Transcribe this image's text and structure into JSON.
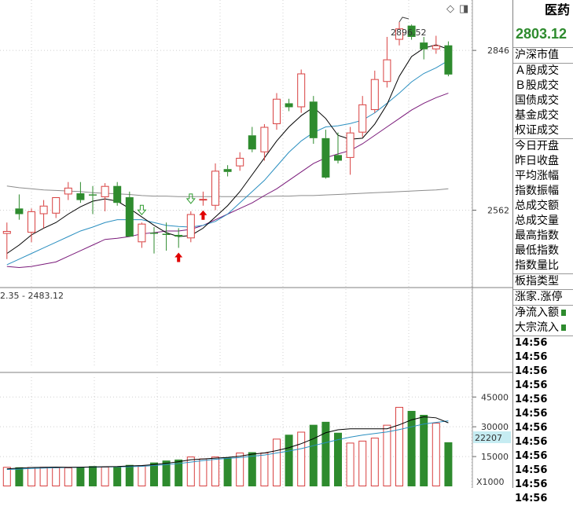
{
  "sidebar": {
    "sector_name": "医药",
    "last_price": "2803.12",
    "items": [
      "沪深市值",
      "Ａ股成交",
      "Ｂ股成交",
      "国债成交",
      "基金成交",
      "权证成交",
      "今日开盘",
      "昨日收盘",
      "平均涨幅",
      "指数振幅",
      "总成交额",
      "总成交量",
      "最高指数",
      "最低指数",
      "指数量比",
      "板指类型",
      "涨家.涨停",
      "净流入额",
      "大宗流入"
    ],
    "times": [
      "14:56",
      "14:56",
      "14:56",
      "14:56",
      "14:56",
      "14:56",
      "14:56",
      "14:56",
      "14:56",
      "14:56",
      "14:56",
      "14:56"
    ]
  },
  "toolbar": {
    "diamond": "◇",
    "window": "◨"
  },
  "colors": {
    "up": "#d84040",
    "down": "#2e8b2e",
    "ma5": "#000000",
    "ma10": "#2a8fc0",
    "ma20": "#7a1a7a",
    "ma60": "#8c8c8c"
  },
  "chart_data": [
    {
      "type": "candlestick",
      "ylim": [
        2430,
        2930
      ],
      "y_ticks": [
        2846,
        2562
      ],
      "highest_label": "2896.52",
      "range_label": "2.35 - 2483.12",
      "ohlc": [
        {
          "o": 2520,
          "h": 2540,
          "l": 2475,
          "c": 2525
        },
        {
          "o": 2565,
          "h": 2590,
          "l": 2545,
          "c": 2555
        },
        {
          "o": 2522,
          "h": 2565,
          "l": 2505,
          "c": 2560
        },
        {
          "o": 2555,
          "h": 2580,
          "l": 2530,
          "c": 2570
        },
        {
          "o": 2556,
          "h": 2580,
          "l": 2548,
          "c": 2585
        },
        {
          "o": 2590,
          "h": 2612,
          "l": 2580,
          "c": 2602
        },
        {
          "o": 2592,
          "h": 2612,
          "l": 2575,
          "c": 2580
        },
        {
          "o": 2590,
          "h": 2605,
          "l": 2555,
          "c": 2588
        },
        {
          "o": 2585,
          "h": 2610,
          "l": 2560,
          "c": 2605
        },
        {
          "o": 2605,
          "h": 2612,
          "l": 2570,
          "c": 2575
        },
        {
          "o": 2585,
          "h": 2595,
          "l": 2525,
          "c": 2515
        },
        {
          "o": 2505,
          "h": 2540,
          "l": 2495,
          "c": 2538
        },
        {
          "o": 2522,
          "h": 2532,
          "l": 2485,
          "c": 2520
        },
        {
          "o": 2520,
          "h": 2540,
          "l": 2490,
          "c": 2518
        },
        {
          "o": 2518,
          "h": 2530,
          "l": 2495,
          "c": 2515
        },
        {
          "o": 2512,
          "h": 2560,
          "l": 2505,
          "c": 2555
        },
        {
          "o": 2580,
          "h": 2595,
          "l": 2570,
          "c": 2582
        },
        {
          "o": 2570,
          "h": 2645,
          "l": 2562,
          "c": 2632
        },
        {
          "o": 2635,
          "h": 2642,
          "l": 2622,
          "c": 2630
        },
        {
          "o": 2640,
          "h": 2665,
          "l": 2632,
          "c": 2655
        },
        {
          "o": 2695,
          "h": 2710,
          "l": 2665,
          "c": 2670
        },
        {
          "o": 2665,
          "h": 2715,
          "l": 2650,
          "c": 2710
        },
        {
          "o": 2715,
          "h": 2770,
          "l": 2705,
          "c": 2760
        },
        {
          "o": 2752,
          "h": 2760,
          "l": 2738,
          "c": 2745
        },
        {
          "o": 2745,
          "h": 2812,
          "l": 2735,
          "c": 2805
        },
        {
          "o": 2755,
          "h": 2765,
          "l": 2680,
          "c": 2690
        },
        {
          "o": 2690,
          "h": 2705,
          "l": 2618,
          "c": 2620
        },
        {
          "o": 2660,
          "h": 2700,
          "l": 2645,
          "c": 2650
        },
        {
          "o": 2655,
          "h": 2710,
          "l": 2625,
          "c": 2700
        },
        {
          "o": 2700,
          "h": 2765,
          "l": 2692,
          "c": 2750
        },
        {
          "o": 2740,
          "h": 2810,
          "l": 2735,
          "c": 2795
        },
        {
          "o": 2790,
          "h": 2870,
          "l": 2780,
          "c": 2830
        },
        {
          "o": 2865,
          "h": 2896.52,
          "l": 2855,
          "c": 2885
        },
        {
          "o": 2890,
          "h": 2892,
          "l": 2865,
          "c": 2870
        },
        {
          "o": 2860,
          "h": 2870,
          "l": 2830,
          "c": 2848
        },
        {
          "o": 2848,
          "h": 2872,
          "l": 2840,
          "c": 2855
        },
        {
          "o": 2855,
          "h": 2862,
          "l": 2800,
          "c": 2803.12
        }
      ],
      "ma5": [
        2485,
        2500,
        2518,
        2530,
        2540,
        2555,
        2568,
        2578,
        2582,
        2578,
        2565,
        2550,
        2535,
        2522,
        2515,
        2517,
        2530,
        2550,
        2570,
        2595,
        2625,
        2655,
        2685,
        2710,
        2730,
        2745,
        2725,
        2695,
        2688,
        2690,
        2715,
        2750,
        2800,
        2835,
        2850,
        2856,
        2848
      ],
      "ma10": [
        2465,
        2475,
        2485,
        2495,
        2505,
        2515,
        2525,
        2532,
        2540,
        2545,
        2545,
        2545,
        2540,
        2535,
        2533,
        2532,
        2535,
        2542,
        2555,
        2575,
        2595,
        2615,
        2640,
        2665,
        2685,
        2700,
        2710,
        2712,
        2716,
        2722,
        2735,
        2752,
        2770,
        2790,
        2805,
        2815,
        2828
      ],
      "ma20": [
        2462,
        2460,
        2462,
        2466,
        2470,
        2480,
        2490,
        2500,
        2510,
        2512,
        2515,
        2520,
        2522,
        2525,
        2525,
        2528,
        2535,
        2545,
        2555,
        2565,
        2575,
        2588,
        2600,
        2615,
        2630,
        2645,
        2655,
        2662,
        2668,
        2680,
        2695,
        2710,
        2725,
        2740,
        2752,
        2762,
        2770
      ],
      "ma60": [
        2605,
        2602,
        2600,
        2598,
        2597,
        2596,
        2595,
        2593,
        2592,
        2591,
        2590,
        2588,
        2587,
        2587,
        2586,
        2586,
        2586,
        2586,
        2586,
        2586,
        2586,
        2586,
        2587,
        2587,
        2588,
        2588,
        2589,
        2590,
        2591,
        2592,
        2593,
        2594,
        2595,
        2596,
        2597,
        2598,
        2600
      ],
      "up_arrows": [
        14,
        16
      ],
      "down_arrows": [
        11,
        15
      ]
    },
    {
      "type": "bar",
      "ylim": [
        0,
        55000
      ],
      "y_ticks": [
        45000,
        30000,
        15000
      ],
      "current_label": "22207",
      "unit_label": "X1000",
      "volume": [
        9800,
        9600,
        9700,
        9800,
        9600,
        9500,
        9700,
        10200,
        9900,
        10000,
        10800,
        10500,
        12000,
        13000,
        13500,
        15000,
        14000,
        15000,
        14500,
        17000,
        17200,
        17000,
        24000,
        26000,
        27500,
        31000,
        32500,
        27000,
        22000,
        23000,
        24500,
        31000,
        40000,
        38000,
        36000,
        32000,
        22207
      ],
      "vol_ma5": [
        8800,
        9200,
        9500,
        9600,
        9700,
        9600,
        9650,
        9800,
        9900,
        10000,
        10300,
        10500,
        11000,
        11600,
        12400,
        13400,
        13800,
        14200,
        14600,
        15200,
        16200,
        16800,
        18000,
        19500,
        21500,
        24000,
        27000,
        28500,
        29000,
        29000,
        29000,
        29000,
        31000,
        33500,
        35000,
        34500,
        32000
      ],
      "vol_ma10": [
        8500,
        8700,
        9000,
        9200,
        9400,
        9500,
        9600,
        9700,
        9800,
        9850,
        9900,
        10100,
        10500,
        11000,
        11500,
        12200,
        13000,
        13600,
        14100,
        14500,
        15200,
        15800,
        16800,
        17800,
        19000,
        20500,
        22000,
        23500,
        24800,
        25800,
        26600,
        27400,
        28600,
        30000,
        31400,
        32200,
        33000
      ]
    }
  ]
}
